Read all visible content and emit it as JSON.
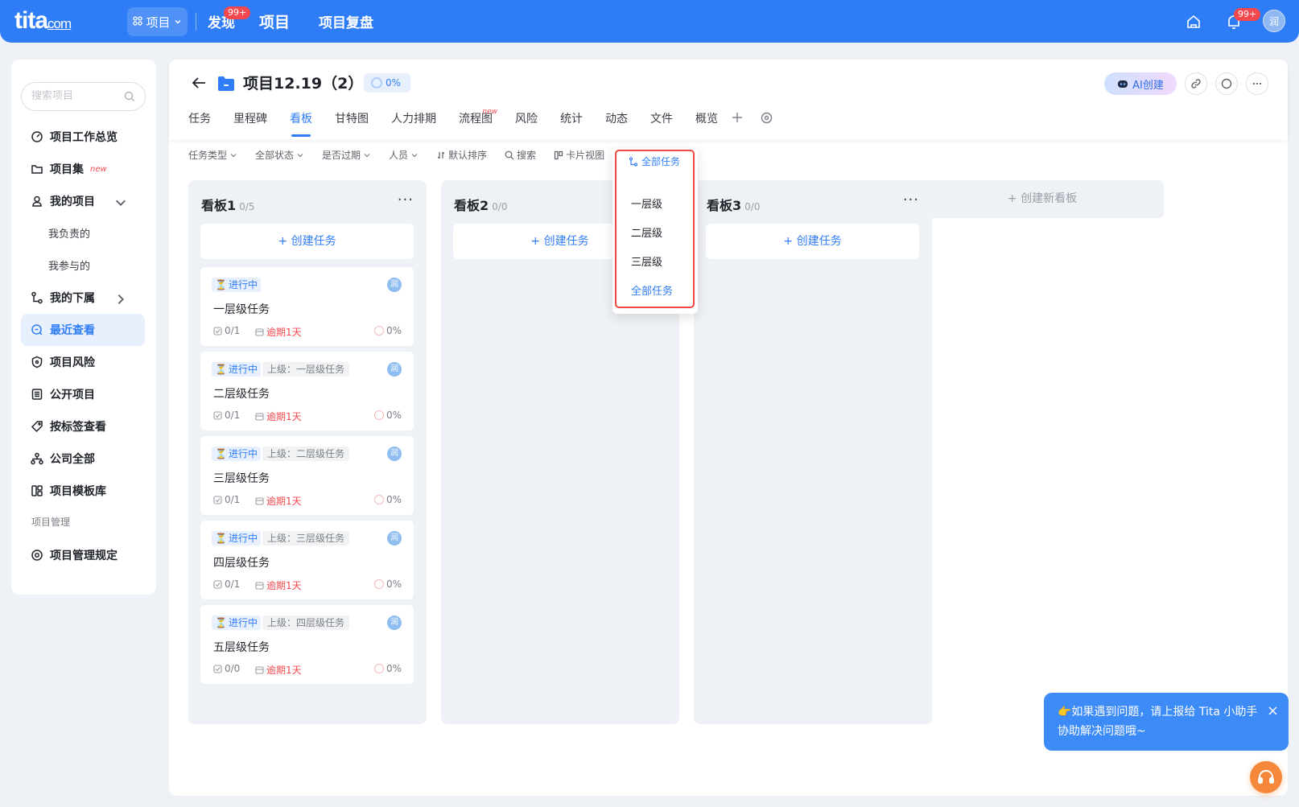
{
  "topbar": {
    "logo": "tita",
    "logo_suffix": "com",
    "module_switch": "项目",
    "nav": [
      {
        "label": "发现",
        "badge": "99+"
      },
      {
        "label": "项目"
      },
      {
        "label": "项目复盘"
      }
    ],
    "notify_badge": "99+",
    "avatar": "润"
  },
  "sidebar": {
    "search_placeholder": "搜索项目",
    "items": [
      {
        "label": "项目工作总览"
      },
      {
        "label": "项目集",
        "tag": "new"
      },
      {
        "label": "我的项目"
      },
      {
        "label": "我负责的"
      },
      {
        "label": "我参与的"
      },
      {
        "label": "我的下属"
      },
      {
        "label": "最近查看"
      },
      {
        "label": "项目风险"
      },
      {
        "label": "公开项目"
      },
      {
        "label": "按标签查看"
      },
      {
        "label": "公司全部"
      },
      {
        "label": "项目模板库"
      },
      {
        "label": "项目管理"
      },
      {
        "label": "项目管理规定"
      }
    ]
  },
  "project": {
    "title": "项目12.19（2）",
    "progress": "0%",
    "ai_button": "AI创建"
  },
  "tabs": [
    {
      "label": "任务"
    },
    {
      "label": "里程碑"
    },
    {
      "label": "看板",
      "active": true
    },
    {
      "label": "甘特图"
    },
    {
      "label": "人力排期"
    },
    {
      "label": "流程图",
      "tag": "new"
    },
    {
      "label": "风险"
    },
    {
      "label": "统计"
    },
    {
      "label": "动态"
    },
    {
      "label": "文件"
    },
    {
      "label": "概览"
    }
  ],
  "filters": {
    "task_type": "任务类型",
    "status": "全部状态",
    "overdue": "是否过期",
    "people": "人员",
    "sort": "默认排序",
    "search": "搜索",
    "view": "卡片视图",
    "hierarchy": "全部任务"
  },
  "hierarchy_dropdown": {
    "header": "全部任务",
    "options": [
      "一层级",
      "二层级",
      "三层级",
      "全部任务"
    ],
    "selected": "全部任务"
  },
  "boards": [
    {
      "title": "看板1",
      "count": "0/5",
      "create_label": "+ 创建任务",
      "cards": [
        {
          "status": "进行中",
          "parent": "",
          "name": "一层级任务",
          "subtasks": "0/1",
          "due": "逾期1天",
          "progress": "0%",
          "avatar": "润"
        },
        {
          "status": "进行中",
          "parent": "上级：一层级任务",
          "name": "二层级任务",
          "subtasks": "0/1",
          "due": "逾期1天",
          "progress": "0%",
          "avatar": "润"
        },
        {
          "status": "进行中",
          "parent": "上级：二层级任务",
          "name": "三层级任务",
          "subtasks": "0/1",
          "due": "逾期1天",
          "progress": "0%",
          "avatar": "润"
        },
        {
          "status": "进行中",
          "parent": "上级：三层级任务",
          "name": "四层级任务",
          "subtasks": "0/1",
          "due": "逾期1天",
          "progress": "0%",
          "avatar": "润"
        },
        {
          "status": "进行中",
          "parent": "上级：四层级任务",
          "name": "五层级任务",
          "subtasks": "0/0",
          "due": "逾期1天",
          "progress": "0%",
          "avatar": "润"
        }
      ]
    },
    {
      "title": "看板2",
      "count": "0/0",
      "create_label": "+ 创建任务",
      "cards": []
    },
    {
      "title": "看板3",
      "count": "0/0",
      "create_label": "+ 创建任务",
      "cards": []
    }
  ],
  "new_board_label": "+ 创建新看板",
  "toast": {
    "text": "👉如果遇到问题，请上报给 Tita 小助手协助解决问题哦~"
  },
  "colors": {
    "primary": "#2f7df6",
    "overdue": "#f5484e",
    "highlight_border": "#f04a40"
  }
}
